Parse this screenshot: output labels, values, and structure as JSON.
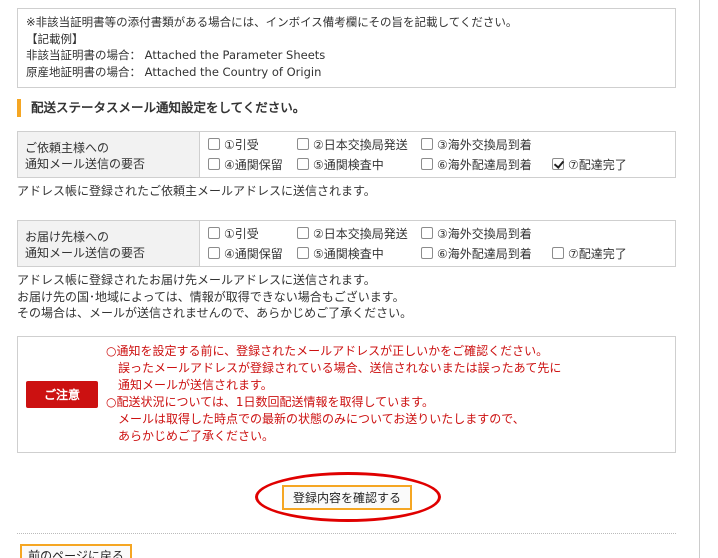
{
  "note_box": {
    "lines": [
      "※非該当証明書等の添付書類がある場合には、インボイス備考欄にその旨を記載してください。",
      "【記載例】",
      "非該当証明書の場合： Attached the Parameter Sheets",
      "原産地証明書の場合： Attached the Country of Origin"
    ]
  },
  "section_heading": "配送ステータスメール通知設定をしてください。",
  "requester": {
    "label_line1": "ご依頼主様への",
    "label_line2": "通知メール送信の要否",
    "options": [
      {
        "label": "①引受",
        "checked": false
      },
      {
        "label": "②日本交換局発送",
        "checked": false
      },
      {
        "label": "③海外交換局到着",
        "checked": false
      },
      {
        "label": "④通関保留",
        "checked": false
      },
      {
        "label": "⑤通関検査中",
        "checked": false
      },
      {
        "label": "⑥海外配達局到着",
        "checked": false
      },
      {
        "label": "⑦配達完了",
        "checked": true
      }
    ],
    "info": "アドレス帳に登録されたご依頼主メールアドレスに送信されます。"
  },
  "recipient": {
    "label_line1": "お届け先様への",
    "label_line2": "通知メール送信の要否",
    "options": [
      {
        "label": "①引受",
        "checked": false
      },
      {
        "label": "②日本交換局発送",
        "checked": false
      },
      {
        "label": "③海外交換局到着",
        "checked": false
      },
      {
        "label": "④通関保留",
        "checked": false
      },
      {
        "label": "⑤通関検査中",
        "checked": false
      },
      {
        "label": "⑥海外配達局到着",
        "checked": false
      },
      {
        "label": "⑦配達完了",
        "checked": false
      }
    ],
    "info_lines": [
      "アドレス帳に登録されたお届け先メールアドレスに送信されます。",
      "お届け先の国･地域によっては、情報が取得できない場合もございます。",
      "その場合は、メールが送信されませんので、あらかじめご了承ください。"
    ]
  },
  "caution": {
    "badge": "ご注意",
    "lines": [
      "○通知を設定する前に、登録されたメールアドレスが正しいかをご確認ください。",
      "誤ったメールアドレスが登録されている場合、送信されないまたは誤ったあて先に",
      "通知メールが送信されます。",
      "○配送状況については、1日数回配送情報を取得しています。",
      "メールは取得した時点での最新の状態のみについてお送りいたしますので、",
      "あらかじめご了承ください。"
    ]
  },
  "buttons": {
    "confirm": "登録内容を確認する",
    "back": "前のページに戻る"
  },
  "colors": {
    "accent_orange": "#f5a623",
    "caution_red": "#cc1111",
    "highlight_circle": "#e00000"
  }
}
